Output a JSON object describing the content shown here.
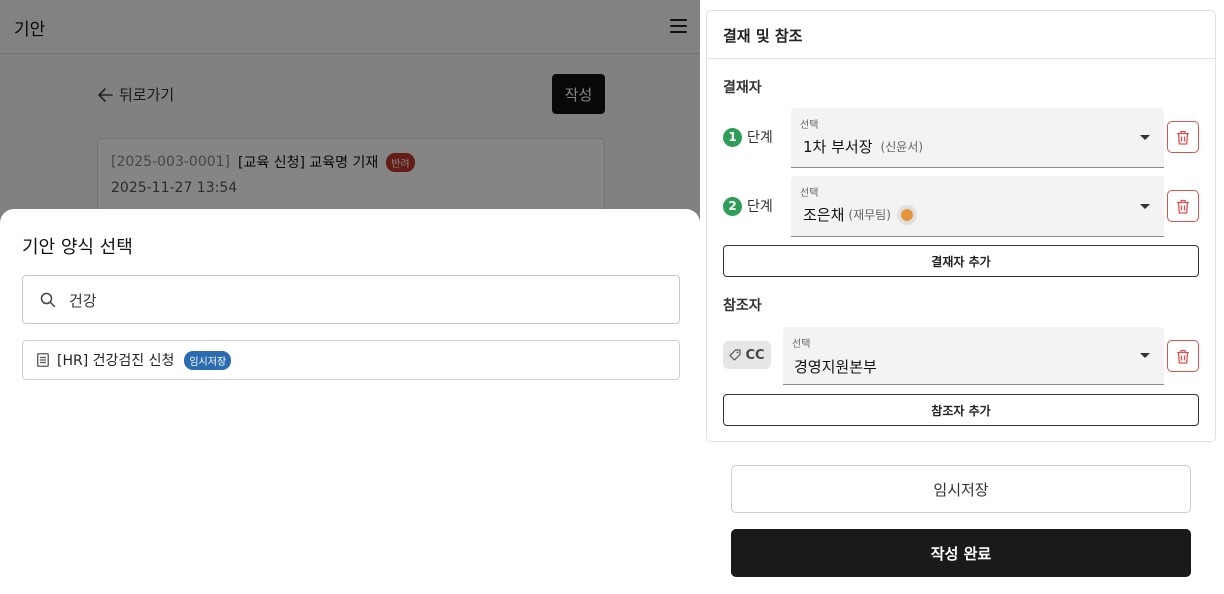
{
  "background_page": {
    "app_title": "기안",
    "back_label": "뒤로가기",
    "write_button": "작성",
    "doc_card": {
      "code": "[2025-003-0001]",
      "title": "[교육 신청] 교육명 기재",
      "badge": "반려",
      "date": "2025-11-27 13:54"
    }
  },
  "form_select_sheet": {
    "title": "기안 양식 선택",
    "search_value": "건강",
    "results": [
      {
        "label": "[HR] 건강검진 신청",
        "badge": "임시저장"
      }
    ]
  },
  "approval_panel": {
    "title": "결재 및 참조",
    "approvers_label": "결재자",
    "select_caption": "선택",
    "approvers": [
      {
        "step_number": "1",
        "step_label": "단계",
        "name": "1차 부서장",
        "sub": "(신윤서)"
      },
      {
        "step_number": "2",
        "step_label": "단계",
        "name": "조은채",
        "sub": "(재무팀)"
      }
    ],
    "add_approver_label": "결재자 추가",
    "references_label": "참조자",
    "references": [
      {
        "chip": "CC",
        "name": "경영지원본부"
      }
    ],
    "add_reference_label": "참조자 추가"
  },
  "actions": {
    "temp_save_label": "임시저장",
    "submit_label": "작성 완료"
  },
  "colors": {
    "step_badge": "#2e9d5a",
    "delete_border": "#d9534f",
    "reject_badge": "#c0392b",
    "temp_badge": "#2b6cb0",
    "submit_bg": "#1a1a1a"
  }
}
